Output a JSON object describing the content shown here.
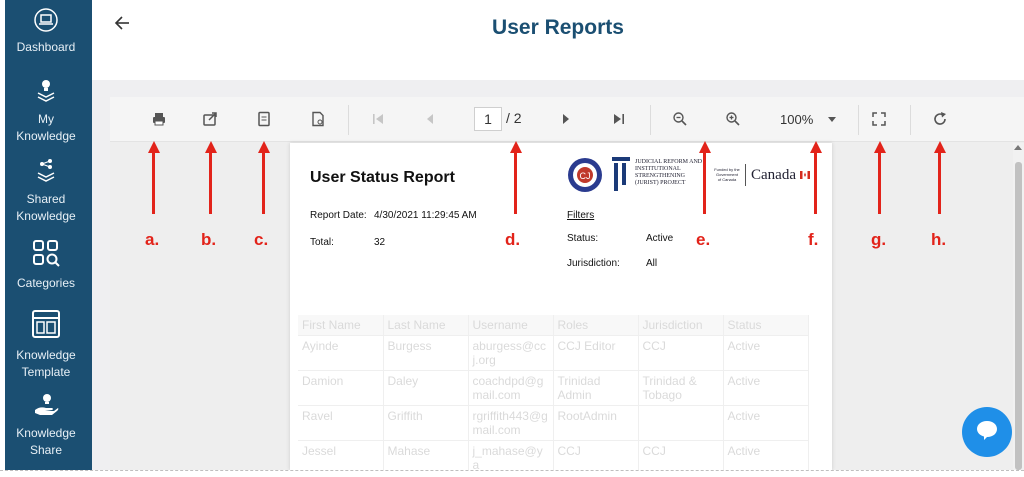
{
  "sidebar": {
    "items": [
      {
        "label": "Dashboard",
        "icon": "laptop-icon"
      },
      {
        "label": "My Knowledge",
        "icon": "lightbulb-stack-icon"
      },
      {
        "label": "Shared Knowledge",
        "icon": "share-stack-icon"
      },
      {
        "label": "Categories",
        "icon": "categories-grid-icon"
      },
      {
        "label": "Knowledge Template",
        "icon": "template-icon"
      },
      {
        "label": "Knowledge Share",
        "icon": "hand-lightbulb-icon"
      }
    ]
  },
  "header": {
    "title": "User Reports",
    "back_icon": "back-arrow-icon"
  },
  "toolbar": {
    "page_current": "1",
    "page_total": "/ 2",
    "zoom": "100%",
    "buttons": [
      "print-icon",
      "export-icon",
      "document-icon",
      "file-settings-icon",
      "first-page-icon",
      "prev-page-icon",
      "next-page-icon",
      "last-page-icon",
      "zoom-out-icon",
      "zoom-in-icon",
      "fullscreen-icon",
      "refresh-icon"
    ]
  },
  "report": {
    "title": "User Status Report",
    "report_date_label": "Report Date:",
    "report_date": "4/30/2021 11:29:45 AM",
    "total_label": "Total:",
    "total": "32",
    "filters_title": "Filters",
    "status_label": "Status:",
    "status_value": "Active",
    "jurisdiction_label": "Jurisdiction:",
    "jurisdiction_value": "All",
    "logo_jurist_line1": "JUDICIAL REFORM AND",
    "logo_jurist_line2": "INSTITUTIONAL",
    "logo_jurist_line3": "STRENGTHENING",
    "logo_jurist_line4": "(JURIST) PROJECT",
    "logo_funded_line1": "Funded by the",
    "logo_funded_line2": "Government",
    "logo_funded_line3": "of Canada",
    "logo_canada": "Canada"
  },
  "table": {
    "headers": [
      "First Name",
      "Last Name",
      "Username",
      "Roles",
      "Jurisdiction",
      "Status"
    ],
    "rows": [
      [
        "Ayinde",
        "Burgess",
        "aburgess@ccj.org",
        "CCJ Editor",
        "CCJ",
        "Active"
      ],
      [
        "Damion",
        "Daley",
        "coachdpd@gmail.com",
        "Trinidad Admin",
        "Trinidad & Tobago",
        "Active"
      ],
      [
        "Ravel",
        "Griffith",
        "rgriffith443@gmail.com",
        "RootAdmin",
        "",
        "Active"
      ],
      [
        "Jessel",
        "Mahase",
        "j_mahase@ya",
        "CCJ",
        "CCJ",
        "Active"
      ]
    ]
  },
  "annotations": [
    "a.",
    "b.",
    "c.",
    "d.",
    "e.",
    "f.",
    "g.",
    "h."
  ],
  "colors": {
    "sidebar": "#1b4f72",
    "title": "#1b4f72",
    "annotation": "#e2231a",
    "chat": "#1f8fe8"
  },
  "chat_icon": "chat-bubble-icon"
}
